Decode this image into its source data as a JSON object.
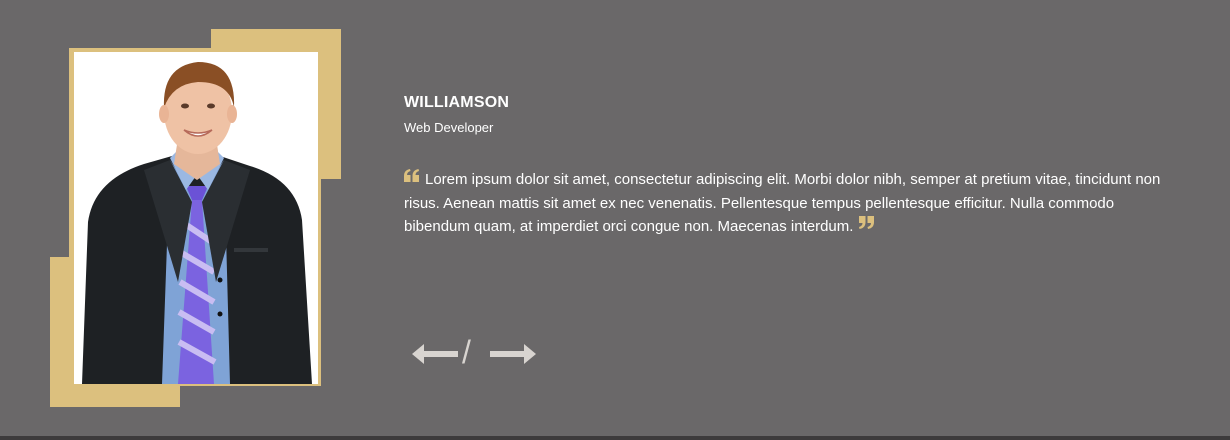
{
  "testimonial": {
    "name": "WILLIAMSON",
    "role": "Web Developer",
    "quote": "Lorem ipsum dolor sit amet, consectetur adipiscing elit. Morbi dolor nibh, semper at pretium vitae, tincidunt non risus. Aenean mattis sit amet ex nec venenatis. Pellentesque tempus pellentesque efficitur. Nulla commodo bibendum quam, at imperdiet orci congue non. Maecenas interdum."
  },
  "navigation": {
    "prev_icon": "arrow-left-icon",
    "separator": "/",
    "next_icon": "arrow-right-icon"
  },
  "colors": {
    "background": "#6a6869",
    "accent_gold": "#dcc07e",
    "text": "#ffffff",
    "arrow": "#d8d4d0",
    "bottom_bar": "#3d3b3c"
  },
  "icons": {
    "open_quote": "quote-open-icon",
    "close_quote": "quote-close-icon",
    "photo": "person-portrait"
  }
}
